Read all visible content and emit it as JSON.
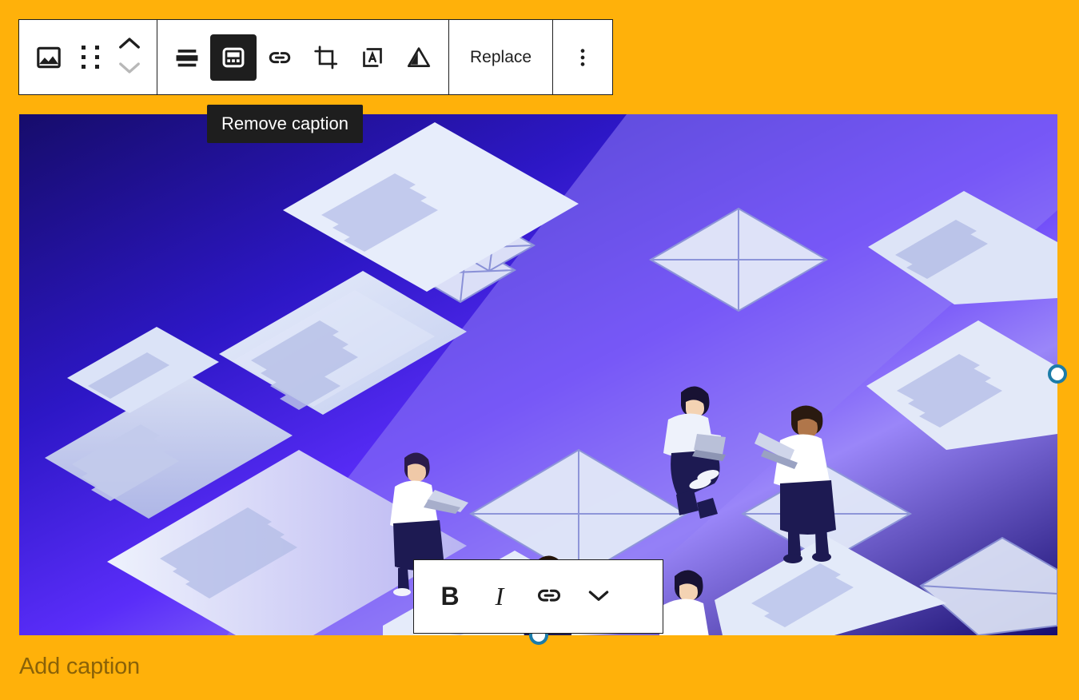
{
  "canvas": {
    "background_color": "#ffb10a"
  },
  "block_toolbar": {
    "block_type_label": "Image",
    "block_type_icon": "image-icon",
    "drag_handle_icon": "drag-handle-icon",
    "move_up_icon": "chevron-up-icon",
    "move_down_icon": "chevron-down-icon",
    "buttons": [
      {
        "name": "align-button",
        "icon": "align-center-icon",
        "label": "Align",
        "pressed": false
      },
      {
        "name": "caption-button",
        "icon": "caption-icon",
        "label": "Remove caption",
        "pressed": true
      },
      {
        "name": "link-button",
        "icon": "link-icon",
        "label": "Link",
        "pressed": false
      },
      {
        "name": "crop-button",
        "icon": "crop-icon",
        "label": "Crop",
        "pressed": false
      },
      {
        "name": "text-over-image-button",
        "icon": "text-over-image-icon",
        "label": "Add text over image",
        "pressed": false
      },
      {
        "name": "duotone-button",
        "icon": "duotone-triangle-icon",
        "label": "Apply duotone filter",
        "pressed": false
      }
    ],
    "replace_label": "Replace",
    "more_options_icon": "more-vertical-icon",
    "more_options_label": "Options"
  },
  "tooltip": {
    "text": "Remove caption"
  },
  "image": {
    "alt": "Isometric illustration of people with laptops among floating wireframe page layouts",
    "background_color": "#160c6b",
    "accent_color": "#4b22f4",
    "paper_color": "#dde5f7"
  },
  "resize_handles": {
    "right_handle": "resize-handle-right",
    "bottom_handle": "resize-handle-bottom",
    "color": "#1c7ca8"
  },
  "caption": {
    "placeholder": "Add caption",
    "color": "#8a6208"
  },
  "format_toolbar": {
    "buttons": [
      {
        "name": "bold-button",
        "icon": "bold-icon",
        "label": "B"
      },
      {
        "name": "italic-button",
        "icon": "italic-icon",
        "label": "I"
      },
      {
        "name": "link-button",
        "icon": "link-icon",
        "label": "Link"
      },
      {
        "name": "more-formats-button",
        "icon": "chevron-down-icon",
        "label": "More"
      }
    ]
  }
}
